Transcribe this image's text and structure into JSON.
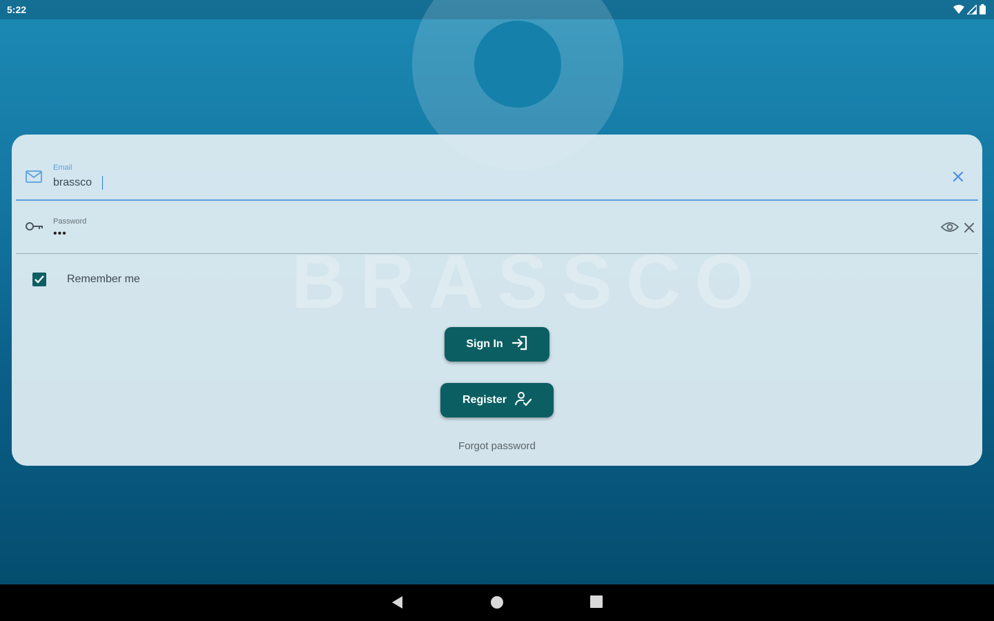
{
  "status_bar": {
    "time": "5:22",
    "icons": [
      "wifi-icon",
      "cell-signal-icon",
      "battery-icon"
    ]
  },
  "watermark_text": "BRASSCO",
  "form": {
    "email": {
      "label": "Email",
      "value": "brassco",
      "icon": "mail-icon",
      "clear_icon": "close-icon"
    },
    "password": {
      "label": "Password",
      "value": "•••",
      "icon": "key-icon",
      "toggle_icon": "eye-icon",
      "clear_icon": "close-icon"
    },
    "remember_me": {
      "label": "Remember me",
      "checked": true
    },
    "sign_in": {
      "label": "Sign In",
      "icon": "login-icon"
    },
    "register": {
      "label": "Register",
      "icon": "person-check-icon"
    },
    "forgot_password": "Forgot password"
  },
  "nav_bar": {
    "items": [
      "back-icon",
      "home-icon",
      "recents-icon"
    ]
  },
  "colors": {
    "accent": "#5aa0e0",
    "button": "#0b5f62",
    "checkbox": "#0c5e63",
    "background_top": "#1c8ab5",
    "background_bottom": "#034a6b"
  }
}
